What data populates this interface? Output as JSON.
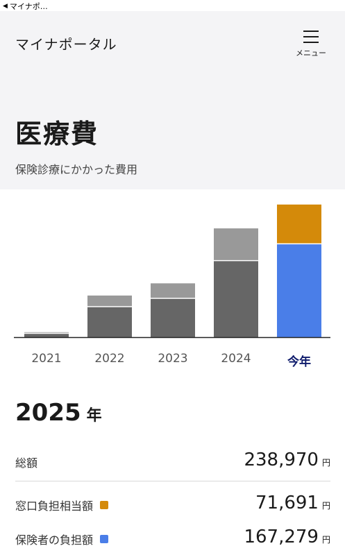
{
  "status_bar": {
    "back_label": "マイナポ…"
  },
  "header": {
    "app_title": "マイナポータル",
    "menu_label": "メニュー"
  },
  "page": {
    "title": "医療費",
    "subtitle": "保険診療にかかった費用"
  },
  "colors": {
    "past_upper": "#999999",
    "past_lower": "#666666",
    "current_upper": "#d48a0a",
    "current_lower": "#4a7ee8",
    "current_year_label": "#0d1a6b"
  },
  "chart_data": {
    "type": "bar",
    "stacked": true,
    "categories": [
      "2021",
      "2022",
      "2023",
      "2024",
      "今年"
    ],
    "series": [
      {
        "name": "保険者の負担額",
        "values": [
          6000,
          54000,
          69000,
          137000,
          167279
        ]
      },
      {
        "name": "窓口負担相当額",
        "values": [
          3000,
          21000,
          28000,
          59000,
          71691
        ]
      }
    ],
    "highlight_category": "今年",
    "ylim": [
      0,
      200000
    ],
    "grid": false,
    "legend": "none"
  },
  "summary": {
    "year": "2025",
    "year_unit": "年",
    "rows": [
      {
        "label": "総額",
        "value": "238,970",
        "unit": "円"
      },
      {
        "label": "窓口負担相当額",
        "value": "71,691",
        "unit": "円",
        "swatch": "#d48a0a"
      },
      {
        "label": "保険者の負担額",
        "value": "167,279",
        "unit": "円",
        "swatch": "#4a7ee8"
      }
    ]
  }
}
